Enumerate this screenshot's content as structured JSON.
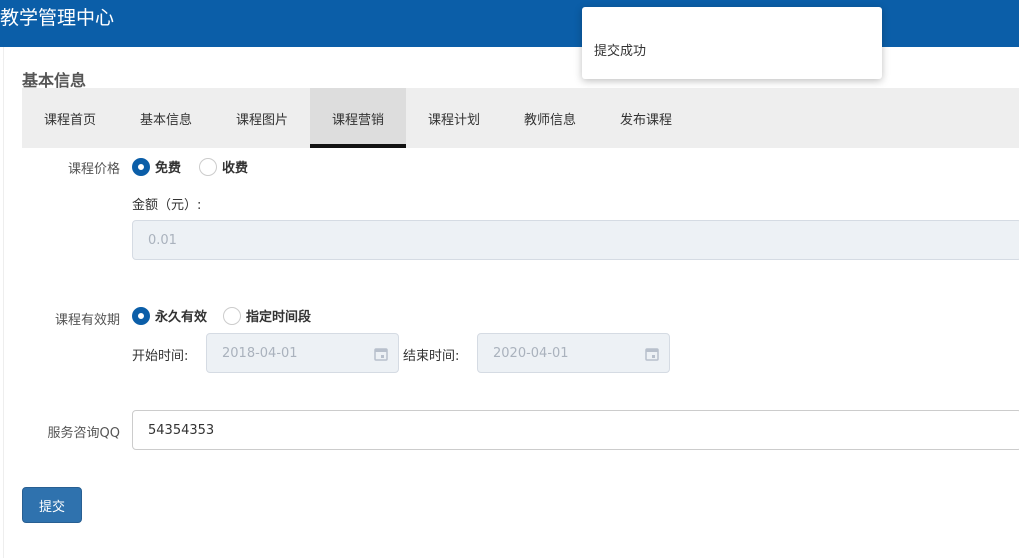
{
  "header": {
    "title": "教学管理中心"
  },
  "section": {
    "title": "基本信息"
  },
  "tabs": [
    {
      "label": "课程首页",
      "active": false
    },
    {
      "label": "基本信息",
      "active": false
    },
    {
      "label": "课程图片",
      "active": false
    },
    {
      "label": "课程营销",
      "active": true
    },
    {
      "label": "课程计划",
      "active": false
    },
    {
      "label": "教师信息",
      "active": false
    },
    {
      "label": "发布课程",
      "active": false
    }
  ],
  "price": {
    "label": "课程价格",
    "options": [
      {
        "label": "免费",
        "checked": true
      },
      {
        "label": "收费",
        "checked": false
      }
    ],
    "amount_label": "金额（元）:",
    "amount_value": "0.01"
  },
  "validity": {
    "label": "课程有效期",
    "options": [
      {
        "label": "永久有效",
        "checked": true
      },
      {
        "label": "指定时间段",
        "checked": false
      }
    ],
    "start_label": "开始时间:",
    "start_value": "2018-04-01",
    "end_label": "结束时间:",
    "end_value": "2020-04-01"
  },
  "qq": {
    "label": "服务咨询QQ",
    "value": "54354353"
  },
  "submit_label": "提交",
  "toast": {
    "message": "提交成功"
  },
  "colors": {
    "header": "#0b5ea8",
    "radio_checked": "#0b5ea8",
    "submit": "#2f72ae"
  }
}
